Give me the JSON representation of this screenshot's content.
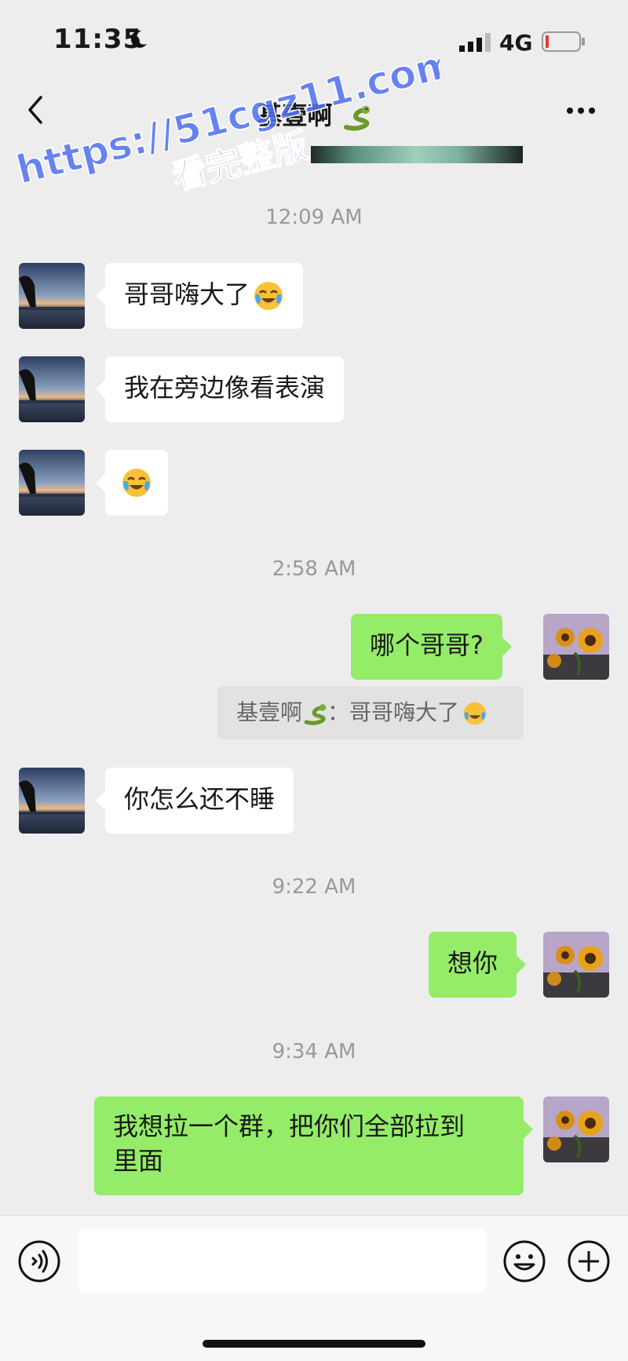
{
  "status": {
    "time": "11:35",
    "network": "4G"
  },
  "header": {
    "title": "基壹啊"
  },
  "watermark": {
    "line1": "https://51cgz11.com",
    "line2": "看完整版"
  },
  "messages": {
    "ts1": "12:09 AM",
    "m1": "哥哥嗨大了",
    "m2": "我在旁边像看表演",
    "ts2": "2:58 AM",
    "m4": "哪个哥哥?",
    "quote_sender": "基壹啊",
    "quote_sep": "：",
    "quote_text": "哥哥嗨大了",
    "m5": "你怎么还不睡",
    "ts3": "9:22 AM",
    "m6": "想你",
    "ts4": "9:34 AM",
    "m7_line1": "我想拉一个群，把你们全部拉到",
    "m7_line2": "里面"
  },
  "icons": [
    "moon-icon",
    "signal-icon",
    "battery-icon",
    "back-icon",
    "snake-emoji-icon",
    "more-icon",
    "face-with-tears-emoji-icon",
    "voice-icon",
    "smiley-icon",
    "plus-icon"
  ]
}
